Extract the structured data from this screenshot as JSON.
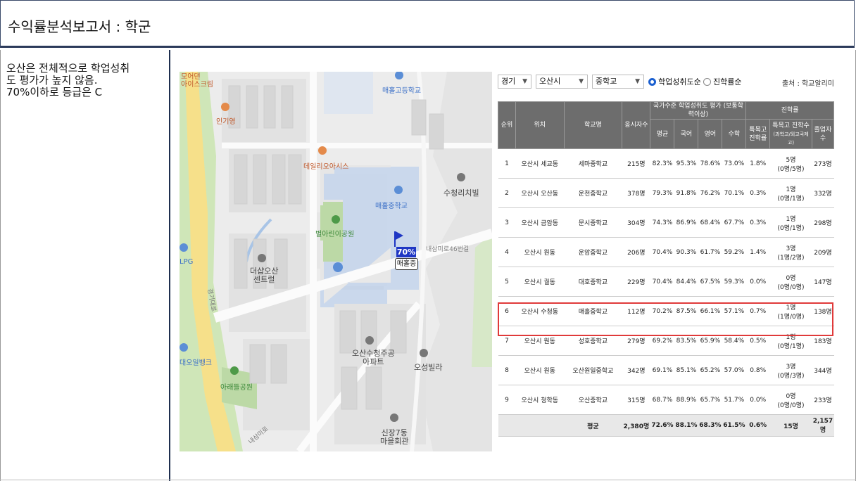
{
  "report": {
    "title": "수익률분석보고서 : 학군"
  },
  "note": {
    "lines": [
      "오산은 전체적으로 학업성취",
      "도 평가가 높지 않음.",
      "70%이하로 등급은 C"
    ]
  },
  "map": {
    "labels": {
      "icecream": "모어댄\n아이스크림",
      "ingiyeong": "인기영",
      "dailyoasis": "데일리오아시스",
      "maehol_high": "매홀고등학교",
      "maehol_mid": "매홀중학교",
      "byeolari_park": "별아린이공원",
      "sucheong_villa": "수청리치빌",
      "desaem_central": "더샵오산\n센트럴",
      "lpg": "LPG",
      "daeo_bank": "대오일뱅크",
      "arae_park": "아래뜰공원",
      "osan_sucheong_apt": "오산수청주공\n아파트",
      "osan_villa": "오성빌라",
      "sinjang_hall": "신장7동\n마을회관",
      "road_naesam": "내삼미로46번길",
      "road_gyeonggi": "경기대로",
      "road_naesammi": "내삼미로"
    },
    "marker": {
      "percent": "70%",
      "name": "매홀중"
    }
  },
  "filters": {
    "province": "경기",
    "city": "오산시",
    "level": "중학교",
    "radio_achievement": "학업성취도순",
    "radio_admission": "진학률순",
    "source": "출처 : 학교알리미"
  },
  "table": {
    "headers": {
      "rank": "순위",
      "location": "위치",
      "school": "학교명",
      "students": "응시자수",
      "group_national": "국가수준 학업성취도 평가 (보통학력이상)",
      "avg": "평균",
      "korean": "국어",
      "english": "영어",
      "math": "수학",
      "group_admission": "진학률",
      "special_rate": "특목고\n진학률",
      "special_count": "특목고 진학수",
      "special_count_sub": "(과학고/외고국제고)",
      "graduates": "졸업자\n수"
    },
    "rows": [
      {
        "rank": "1",
        "location": "오산시 세교동",
        "school": "세마중학교",
        "students": "215명",
        "avg": "82.3%",
        "korean": "95.3%",
        "english": "78.6%",
        "math": "73.0%",
        "special_rate": "1.8%",
        "special_count": "5명",
        "special_detail": "(0명/5명)",
        "graduates": "273명"
      },
      {
        "rank": "2",
        "location": "오산시 오산동",
        "school": "운천중학교",
        "students": "378명",
        "avg": "79.3%",
        "korean": "91.8%",
        "english": "76.2%",
        "math": "70.1%",
        "special_rate": "0.3%",
        "special_count": "1명",
        "special_detail": "(0명/1명)",
        "graduates": "332명"
      },
      {
        "rank": "3",
        "location": "오산시 금암동",
        "school": "문시중학교",
        "students": "304명",
        "avg": "74.3%",
        "korean": "86.9%",
        "english": "68.4%",
        "math": "67.7%",
        "special_rate": "0.3%",
        "special_count": "1명",
        "special_detail": "(0명/1명)",
        "graduates": "298명"
      },
      {
        "rank": "4",
        "location": "오산시 원동",
        "school": "운암중학교",
        "students": "206명",
        "avg": "70.4%",
        "korean": "90.3%",
        "english": "61.7%",
        "math": "59.2%",
        "special_rate": "1.4%",
        "special_count": "3명",
        "special_detail": "(1명/2명)",
        "graduates": "209명"
      },
      {
        "rank": "5",
        "location": "오산시 궐동",
        "school": "대호중학교",
        "students": "229명",
        "avg": "70.4%",
        "korean": "84.4%",
        "english": "67.5%",
        "math": "59.3%",
        "special_rate": "0.0%",
        "special_count": "0명",
        "special_detail": "(0명/0명)",
        "graduates": "147명"
      },
      {
        "rank": "6",
        "location": "오산시 수청동",
        "school": "매홀중학교",
        "students": "112명",
        "avg": "70.2%",
        "korean": "87.5%",
        "english": "66.1%",
        "math": "57.1%",
        "special_rate": "0.7%",
        "special_count": "1명",
        "special_detail": "(1명/0명)",
        "graduates": "138명"
      },
      {
        "rank": "7",
        "location": "오산시 원동",
        "school": "성호중학교",
        "students": "279명",
        "avg": "69.2%",
        "korean": "83.5%",
        "english": "65.9%",
        "math": "58.4%",
        "special_rate": "0.5%",
        "special_count": "1명",
        "special_detail": "(0명/1명)",
        "graduates": "183명"
      },
      {
        "rank": "8",
        "location": "오산시 원동",
        "school": "오산원일중학교",
        "students": "342명",
        "avg": "69.1%",
        "korean": "85.1%",
        "english": "65.2%",
        "math": "57.0%",
        "special_rate": "0.8%",
        "special_count": "3명",
        "special_detail": "(0명/3명)",
        "graduates": "344명"
      },
      {
        "rank": "9",
        "location": "오산시 청학동",
        "school": "오산중학교",
        "students": "315명",
        "avg": "68.7%",
        "korean": "88.9%",
        "english": "65.7%",
        "math": "51.7%",
        "special_rate": "0.0%",
        "special_count": "0명",
        "special_detail": "(0명/0명)",
        "graduates": "233명"
      }
    ],
    "average": {
      "label": "평균",
      "students": "2,380명",
      "avg": "72.6%",
      "korean": "88.1%",
      "english": "68.3%",
      "math": "61.5%",
      "special_rate": "0.6%",
      "special_count": "15명",
      "graduates": "2,157명"
    },
    "highlight_color": "#e03a3a"
  }
}
